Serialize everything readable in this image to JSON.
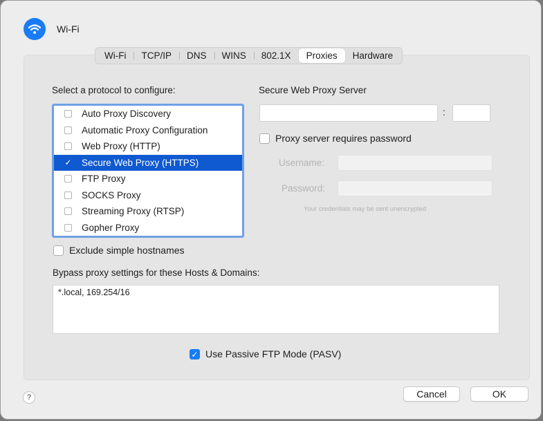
{
  "header": {
    "title": "Wi-Fi",
    "icon": "wifi-icon",
    "accent": "#1a7cf5"
  },
  "tabs": [
    {
      "label": "Wi-Fi",
      "active": false
    },
    {
      "label": "TCP/IP",
      "active": false
    },
    {
      "label": "DNS",
      "active": false
    },
    {
      "label": "WINS",
      "active": false
    },
    {
      "label": "802.1X",
      "active": false
    },
    {
      "label": "Proxies",
      "active": true
    },
    {
      "label": "Hardware",
      "active": false
    }
  ],
  "protocols": {
    "heading": "Select a protocol to configure:",
    "items": [
      {
        "label": "Auto Proxy Discovery",
        "checked": false,
        "selected": false
      },
      {
        "label": "Automatic Proxy Configuration",
        "checked": false,
        "selected": false
      },
      {
        "label": "Web Proxy (HTTP)",
        "checked": false,
        "selected": false
      },
      {
        "label": "Secure Web Proxy (HTTPS)",
        "checked": true,
        "selected": true
      },
      {
        "label": "FTP Proxy",
        "checked": false,
        "selected": false
      },
      {
        "label": "SOCKS Proxy",
        "checked": false,
        "selected": false
      },
      {
        "label": "Streaming Proxy (RTSP)",
        "checked": false,
        "selected": false
      },
      {
        "label": "Gopher Proxy",
        "checked": false,
        "selected": false
      }
    ]
  },
  "server": {
    "heading": "Secure Web Proxy Server",
    "host_value": "",
    "separator": ":",
    "port_value": "",
    "requires_password_label": "Proxy server requires password",
    "requires_password": false,
    "username_label": "Username:",
    "username_value": "",
    "password_label": "Password:",
    "password_value": "",
    "warning": "Your credentials may be sent unencrypted"
  },
  "exclude_simple": {
    "label": "Exclude simple hostnames",
    "checked": false
  },
  "bypass": {
    "label": "Bypass proxy settings for these Hosts & Domains:",
    "value": "*.local, 169.254/16"
  },
  "passive_ftp": {
    "label": "Use Passive FTP Mode (PASV)",
    "checked": true
  },
  "footer": {
    "help_label": "?",
    "cancel_label": "Cancel",
    "ok_label": "OK"
  }
}
